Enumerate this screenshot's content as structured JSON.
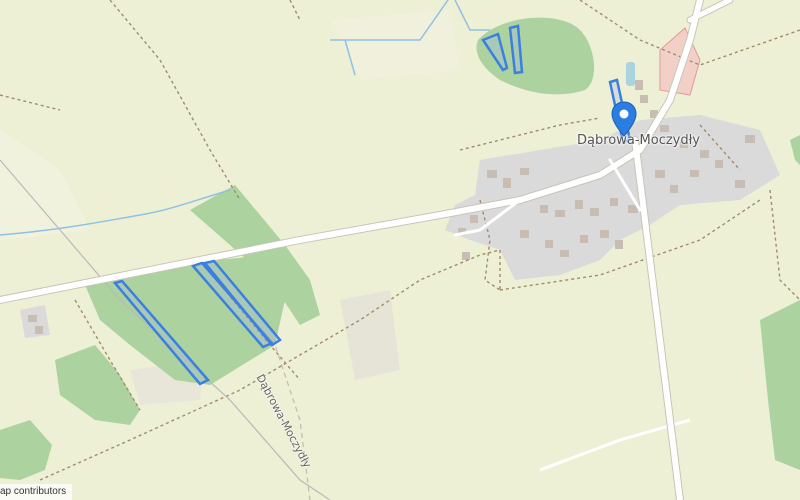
{
  "map": {
    "place_label": "Dąbrowa-Moczydły",
    "road_label": "Dąbrowa-Moczydły",
    "attribution": "ap contributors",
    "marker_icon": "map-pin-icon",
    "colors": {
      "background": "#eef0d5",
      "forest": "#acd29f",
      "residential": "#d9d9d9",
      "road": "#ffffff",
      "road_casing": "#c9c4b8",
      "boundary": "#a08b6a",
      "water": "#8fc1e3",
      "highlight": "#3b7fe0",
      "marker": "#2a7de1",
      "restricted": "#f3c2c2"
    }
  }
}
